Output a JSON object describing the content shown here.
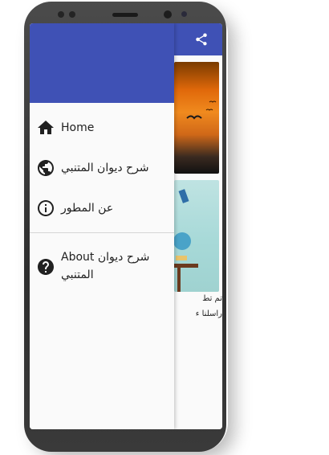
{
  "app": {
    "primary_color": "#3f51b5",
    "share_icon": "share-icon"
  },
  "drawer": {
    "items": [
      {
        "label": "Home",
        "icon": "home-icon"
      },
      {
        "label": "شرح ديوان المتنبي",
        "icon": "globe-icon"
      },
      {
        "label": "عن المطور",
        "icon": "info-icon"
      },
      {
        "label": "About شرح ديوان المتنبي",
        "icon": "help-icon"
      }
    ]
  },
  "content": {
    "snippet_1": "تم تط",
    "snippet_2": "راسلنا ء"
  }
}
